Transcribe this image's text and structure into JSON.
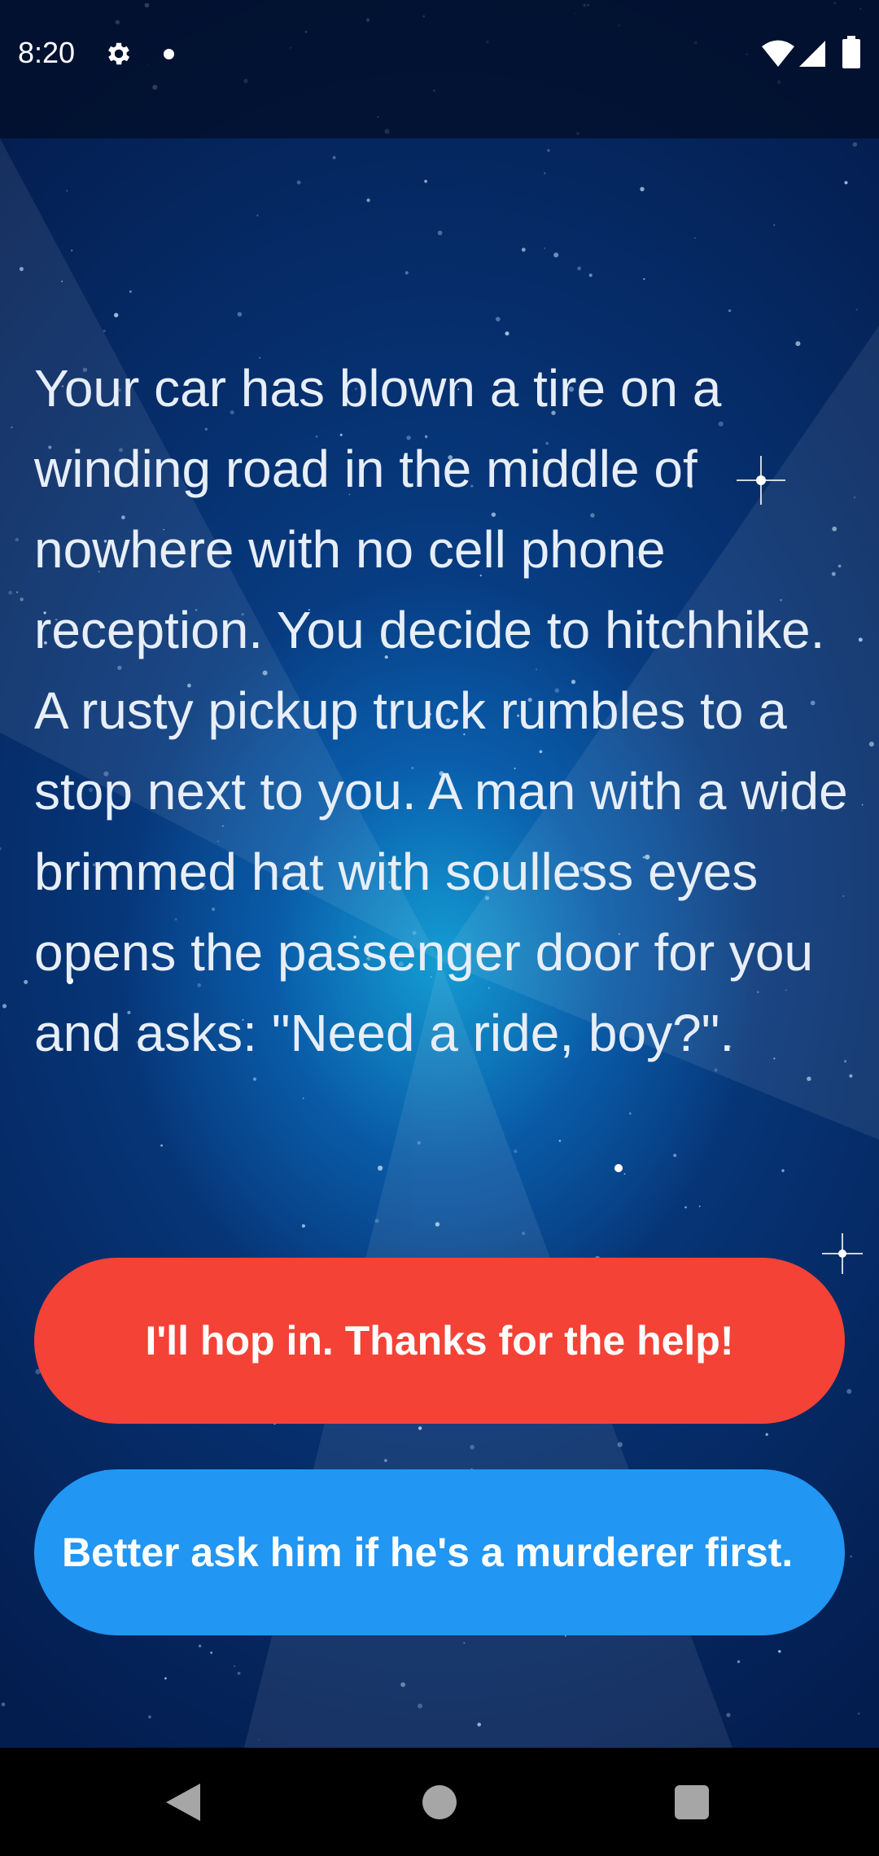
{
  "status_bar": {
    "time": "8:20",
    "icons": [
      "gear-icon",
      "notification-dot-icon",
      "wifi-icon",
      "cell-signal-icon",
      "battery-icon"
    ]
  },
  "story": {
    "text": "Your car has blown a tire on a winding road in the middle of nowhere with no cell phone reception. You decide to hitchhike. A rusty pickup truck rumbles to a stop next to you. A man with a wide brimmed hat with soulless eyes opens the passenger door for you and asks: \"Need a ride, boy?\"."
  },
  "choices": [
    {
      "label": "I'll hop in. Thanks for the help!",
      "color": "#f44236"
    },
    {
      "label": "Better ask him if he's a murderer first.",
      "color": "#2196f3"
    }
  ],
  "nav_bar": {
    "icons": [
      "back-icon",
      "home-icon",
      "recents-icon"
    ]
  },
  "colors": {
    "background_deep": "#041d4f",
    "background_glow": "#16aadc",
    "text": "#e7eef7"
  }
}
